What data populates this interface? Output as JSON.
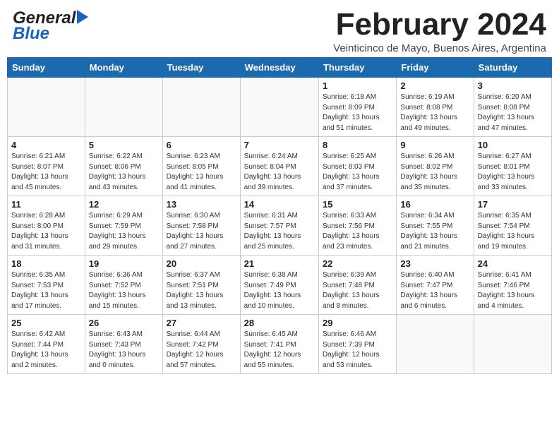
{
  "logo": {
    "general": "General",
    "blue": "Blue"
  },
  "title": "February 2024",
  "location": "Veinticinco de Mayo, Buenos Aires, Argentina",
  "days_of_week": [
    "Sunday",
    "Monday",
    "Tuesday",
    "Wednesday",
    "Thursday",
    "Friday",
    "Saturday"
  ],
  "weeks": [
    [
      {
        "day": "",
        "info": ""
      },
      {
        "day": "",
        "info": ""
      },
      {
        "day": "",
        "info": ""
      },
      {
        "day": "",
        "info": ""
      },
      {
        "day": "1",
        "info": "Sunrise: 6:18 AM\nSunset: 8:09 PM\nDaylight: 13 hours\nand 51 minutes."
      },
      {
        "day": "2",
        "info": "Sunrise: 6:19 AM\nSunset: 8:08 PM\nDaylight: 13 hours\nand 49 minutes."
      },
      {
        "day": "3",
        "info": "Sunrise: 6:20 AM\nSunset: 8:08 PM\nDaylight: 13 hours\nand 47 minutes."
      }
    ],
    [
      {
        "day": "4",
        "info": "Sunrise: 6:21 AM\nSunset: 8:07 PM\nDaylight: 13 hours\nand 45 minutes."
      },
      {
        "day": "5",
        "info": "Sunrise: 6:22 AM\nSunset: 8:06 PM\nDaylight: 13 hours\nand 43 minutes."
      },
      {
        "day": "6",
        "info": "Sunrise: 6:23 AM\nSunset: 8:05 PM\nDaylight: 13 hours\nand 41 minutes."
      },
      {
        "day": "7",
        "info": "Sunrise: 6:24 AM\nSunset: 8:04 PM\nDaylight: 13 hours\nand 39 minutes."
      },
      {
        "day": "8",
        "info": "Sunrise: 6:25 AM\nSunset: 8:03 PM\nDaylight: 13 hours\nand 37 minutes."
      },
      {
        "day": "9",
        "info": "Sunrise: 6:26 AM\nSunset: 8:02 PM\nDaylight: 13 hours\nand 35 minutes."
      },
      {
        "day": "10",
        "info": "Sunrise: 6:27 AM\nSunset: 8:01 PM\nDaylight: 13 hours\nand 33 minutes."
      }
    ],
    [
      {
        "day": "11",
        "info": "Sunrise: 6:28 AM\nSunset: 8:00 PM\nDaylight: 13 hours\nand 31 minutes."
      },
      {
        "day": "12",
        "info": "Sunrise: 6:29 AM\nSunset: 7:59 PM\nDaylight: 13 hours\nand 29 minutes."
      },
      {
        "day": "13",
        "info": "Sunrise: 6:30 AM\nSunset: 7:58 PM\nDaylight: 13 hours\nand 27 minutes."
      },
      {
        "day": "14",
        "info": "Sunrise: 6:31 AM\nSunset: 7:57 PM\nDaylight: 13 hours\nand 25 minutes."
      },
      {
        "day": "15",
        "info": "Sunrise: 6:33 AM\nSunset: 7:56 PM\nDaylight: 13 hours\nand 23 minutes."
      },
      {
        "day": "16",
        "info": "Sunrise: 6:34 AM\nSunset: 7:55 PM\nDaylight: 13 hours\nand 21 minutes."
      },
      {
        "day": "17",
        "info": "Sunrise: 6:35 AM\nSunset: 7:54 PM\nDaylight: 13 hours\nand 19 minutes."
      }
    ],
    [
      {
        "day": "18",
        "info": "Sunrise: 6:35 AM\nSunset: 7:53 PM\nDaylight: 13 hours\nand 17 minutes."
      },
      {
        "day": "19",
        "info": "Sunrise: 6:36 AM\nSunset: 7:52 PM\nDaylight: 13 hours\nand 15 minutes."
      },
      {
        "day": "20",
        "info": "Sunrise: 6:37 AM\nSunset: 7:51 PM\nDaylight: 13 hours\nand 13 minutes."
      },
      {
        "day": "21",
        "info": "Sunrise: 6:38 AM\nSunset: 7:49 PM\nDaylight: 13 hours\nand 10 minutes."
      },
      {
        "day": "22",
        "info": "Sunrise: 6:39 AM\nSunset: 7:48 PM\nDaylight: 13 hours\nand 8 minutes."
      },
      {
        "day": "23",
        "info": "Sunrise: 6:40 AM\nSunset: 7:47 PM\nDaylight: 13 hours\nand 6 minutes."
      },
      {
        "day": "24",
        "info": "Sunrise: 6:41 AM\nSunset: 7:46 PM\nDaylight: 13 hours\nand 4 minutes."
      }
    ],
    [
      {
        "day": "25",
        "info": "Sunrise: 6:42 AM\nSunset: 7:44 PM\nDaylight: 13 hours\nand 2 minutes."
      },
      {
        "day": "26",
        "info": "Sunrise: 6:43 AM\nSunset: 7:43 PM\nDaylight: 13 hours\nand 0 minutes."
      },
      {
        "day": "27",
        "info": "Sunrise: 6:44 AM\nSunset: 7:42 PM\nDaylight: 12 hours\nand 57 minutes."
      },
      {
        "day": "28",
        "info": "Sunrise: 6:45 AM\nSunset: 7:41 PM\nDaylight: 12 hours\nand 55 minutes."
      },
      {
        "day": "29",
        "info": "Sunrise: 6:46 AM\nSunset: 7:39 PM\nDaylight: 12 hours\nand 53 minutes."
      },
      {
        "day": "",
        "info": ""
      },
      {
        "day": "",
        "info": ""
      }
    ]
  ]
}
